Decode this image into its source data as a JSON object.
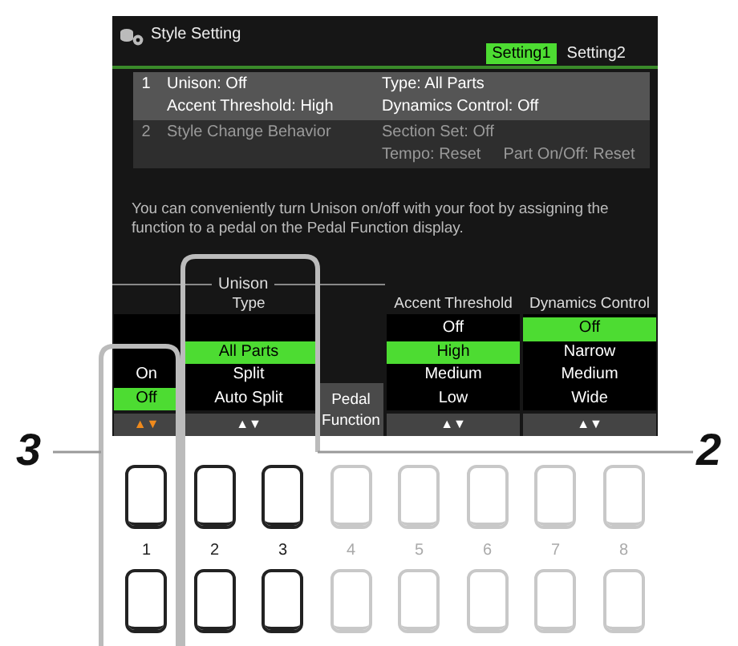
{
  "window": {
    "title": "Style Setting"
  },
  "tabs": [
    {
      "label": "Setting1",
      "selected": true
    },
    {
      "label": "Setting2",
      "selected": false
    }
  ],
  "settings": [
    {
      "number": "1",
      "selected": true,
      "left": [
        "Unison: Off",
        "Accent Threshold: High"
      ],
      "right": [
        [
          "Type: All Parts"
        ],
        [
          "Dynamics Control: Off"
        ]
      ]
    },
    {
      "number": "2",
      "selected": false,
      "left": [
        "Style Change Behavior"
      ],
      "right": [
        [
          "Section Set: Off"
        ],
        [
          "Tempo: Reset",
          "Part On/Off: Reset"
        ]
      ]
    }
  ],
  "message": "You can conveniently turn Unison on/off with your foot by assigning the function to a pedal on the Pedal Function display.",
  "group_label": "Unison",
  "columns": [
    {
      "kind": "narrow-list",
      "items": [
        {
          "label": "On",
          "selected": false
        },
        {
          "label": "Off",
          "selected": true
        }
      ],
      "arrows": "▲▼",
      "arrows_active": true
    },
    {
      "kind": "list",
      "header": "Type",
      "items": [
        {
          "label": "All Parts",
          "selected": true
        },
        {
          "label": "Split",
          "selected": false
        },
        {
          "label": "Auto Split",
          "selected": false
        }
      ],
      "arrows": "▲▼",
      "arrows_active": false
    },
    {
      "kind": "button",
      "label": "Pedal Function"
    },
    {
      "kind": "list",
      "header": "Accent Threshold",
      "items": [
        {
          "label": "Off",
          "selected": false
        },
        {
          "label": "High",
          "selected": true
        },
        {
          "label": "Medium",
          "selected": false
        },
        {
          "label": "Low",
          "selected": false
        }
      ],
      "arrows": "▲▼",
      "arrows_active": false
    },
    {
      "kind": "list",
      "header": "Dynamics Control",
      "items": [
        {
          "label": "Off",
          "selected": true
        },
        {
          "label": "Narrow",
          "selected": false
        },
        {
          "label": "Medium",
          "selected": false
        },
        {
          "label": "Wide",
          "selected": false
        }
      ],
      "arrows": "▲▼",
      "arrows_active": false
    }
  ],
  "panel_buttons": [
    {
      "number": "1",
      "highlighted": true
    },
    {
      "number": "2",
      "highlighted": true
    },
    {
      "number": "3",
      "highlighted": true
    },
    {
      "number": "4",
      "highlighted": false
    },
    {
      "number": "5",
      "highlighted": false
    },
    {
      "number": "6",
      "highlighted": false
    },
    {
      "number": "7",
      "highlighted": false
    },
    {
      "number": "8",
      "highlighted": false
    }
  ],
  "callouts": [
    {
      "label": "3"
    },
    {
      "label": "2"
    }
  ]
}
